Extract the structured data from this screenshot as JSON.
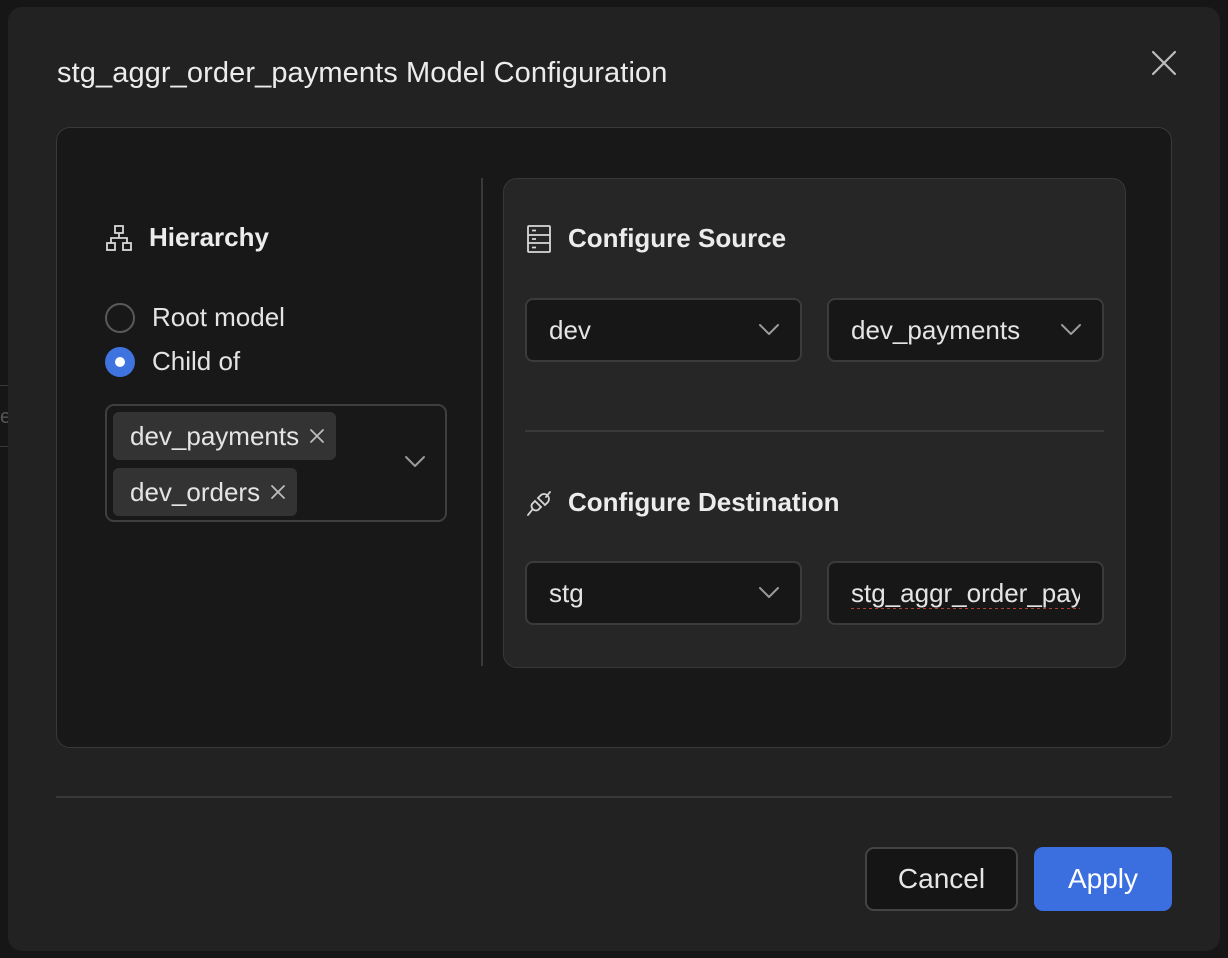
{
  "background": {
    "partial_text": "e"
  },
  "modal": {
    "title": "stg_aggr_order_payments Model Configuration"
  },
  "hierarchy": {
    "heading": "Hierarchy",
    "icon": "sitemap-icon",
    "options": [
      {
        "label": "Root model",
        "selected": false
      },
      {
        "label": "Child of",
        "selected": true
      }
    ],
    "parents": [
      "dev_payments",
      "dev_orders"
    ]
  },
  "source": {
    "heading": "Configure Source",
    "icon": "server-icon",
    "schema": "dev",
    "model": "dev_payments"
  },
  "destination": {
    "heading": "Configure Destination",
    "icon": "plug-icon",
    "schema": "stg",
    "model_name": "stg_aggr_order_payments"
  },
  "footer": {
    "cancel_label": "Cancel",
    "apply_label": "Apply"
  },
  "colors": {
    "accent": "#3b6fdf",
    "modal_bg": "#222222",
    "panel_bg": "#181818"
  }
}
